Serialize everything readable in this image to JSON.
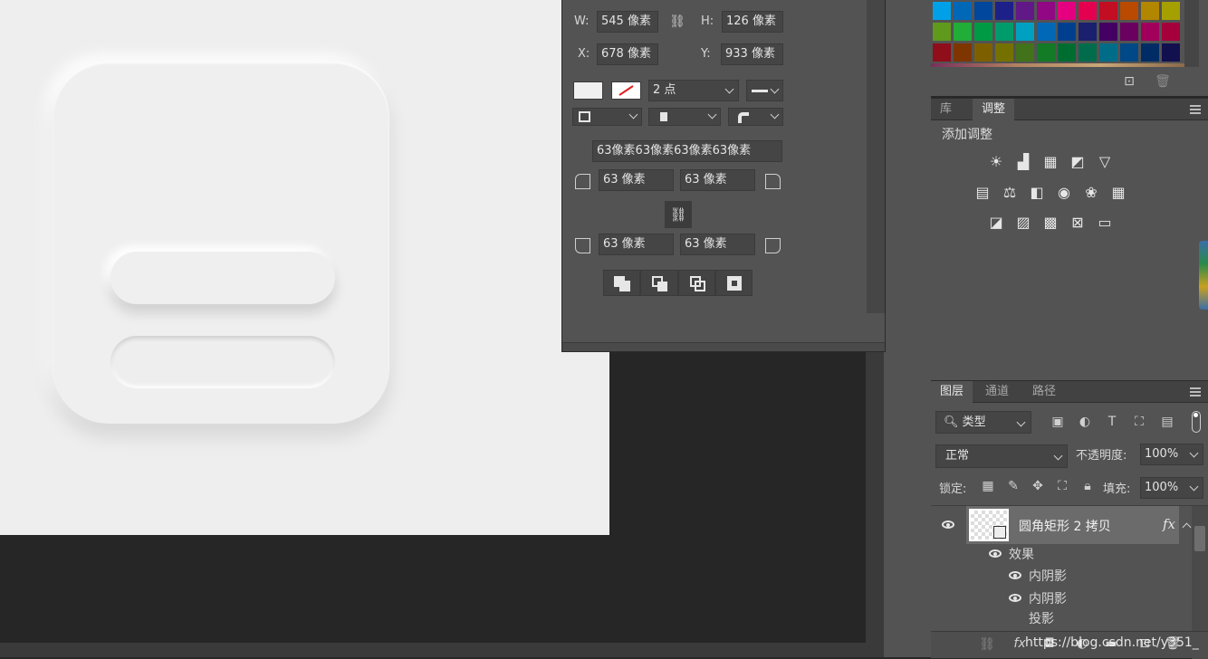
{
  "properties": {
    "w_label": "W:",
    "w_value": "545 像素",
    "h_label": "H:",
    "h_value": "126 像素",
    "x_label": "X:",
    "x_value": "678 像素",
    "y_label": "Y:",
    "y_value": "933 像素",
    "stroke_width": "2 点",
    "all_corners": "63像素63像素63像素63像素",
    "corner_tl": "63 像素",
    "corner_tr": "63 像素",
    "corner_bl": "63 像素",
    "corner_br": "63 像素"
  },
  "swatches": {
    "colors": [
      "#00a0e9",
      "#0068b7",
      "#00479d",
      "#1d2088",
      "#601986",
      "#920783",
      "#e4007f",
      "#e5004f",
      "#c30d23",
      "#b94a00",
      "#b38600",
      "#a5a000",
      "#5f9a1c",
      "#22ac38",
      "#009944",
      "#009b6b",
      "#00a0c1",
      "#0068b7",
      "#003f8e",
      "#1a1f6e",
      "#440062",
      "#6a005f",
      "#a0005c",
      "#a5003c",
      "#8f0e1a",
      "#7f3500",
      "#7e5f00",
      "#757100",
      "#427219",
      "#137a26",
      "#006d30",
      "#006c4b",
      "#006d88",
      "#004986",
      "#002c65",
      "#13104f"
    ]
  },
  "adjustments": {
    "tabs": [
      "库",
      "调整"
    ],
    "active_tab": "调整",
    "heading": "添加调整",
    "row1": [
      "brightness-icon",
      "levels-icon",
      "curves-icon",
      "exposure-icon",
      "vibrance-icon"
    ],
    "row2": [
      "hue-saturation-icon",
      "color-balance-icon",
      "black-white-icon",
      "photo-filter-icon",
      "channel-mixer-icon",
      "color-lookup-icon"
    ],
    "row3": [
      "invert-icon",
      "posterize-icon",
      "threshold-icon",
      "selective-color-icon",
      "gradient-map-icon"
    ]
  },
  "layers": {
    "tabs": [
      "图层",
      "通道",
      "路径"
    ],
    "active_tab": "图层",
    "filter_label": "类型",
    "blend_mode": "正常",
    "opacity_label": "不透明度:",
    "opacity_value": "100%",
    "lock_label": "锁定:",
    "fill_label": "填充:",
    "fill_value": "100%",
    "layer_name": "圆角矩形 2 拷贝",
    "fx": "fx",
    "effects_label": "效果",
    "effects": [
      "内阴影",
      "内阴影",
      "投影"
    ],
    "watermark": "https://blog.csdn.net/y351_"
  }
}
